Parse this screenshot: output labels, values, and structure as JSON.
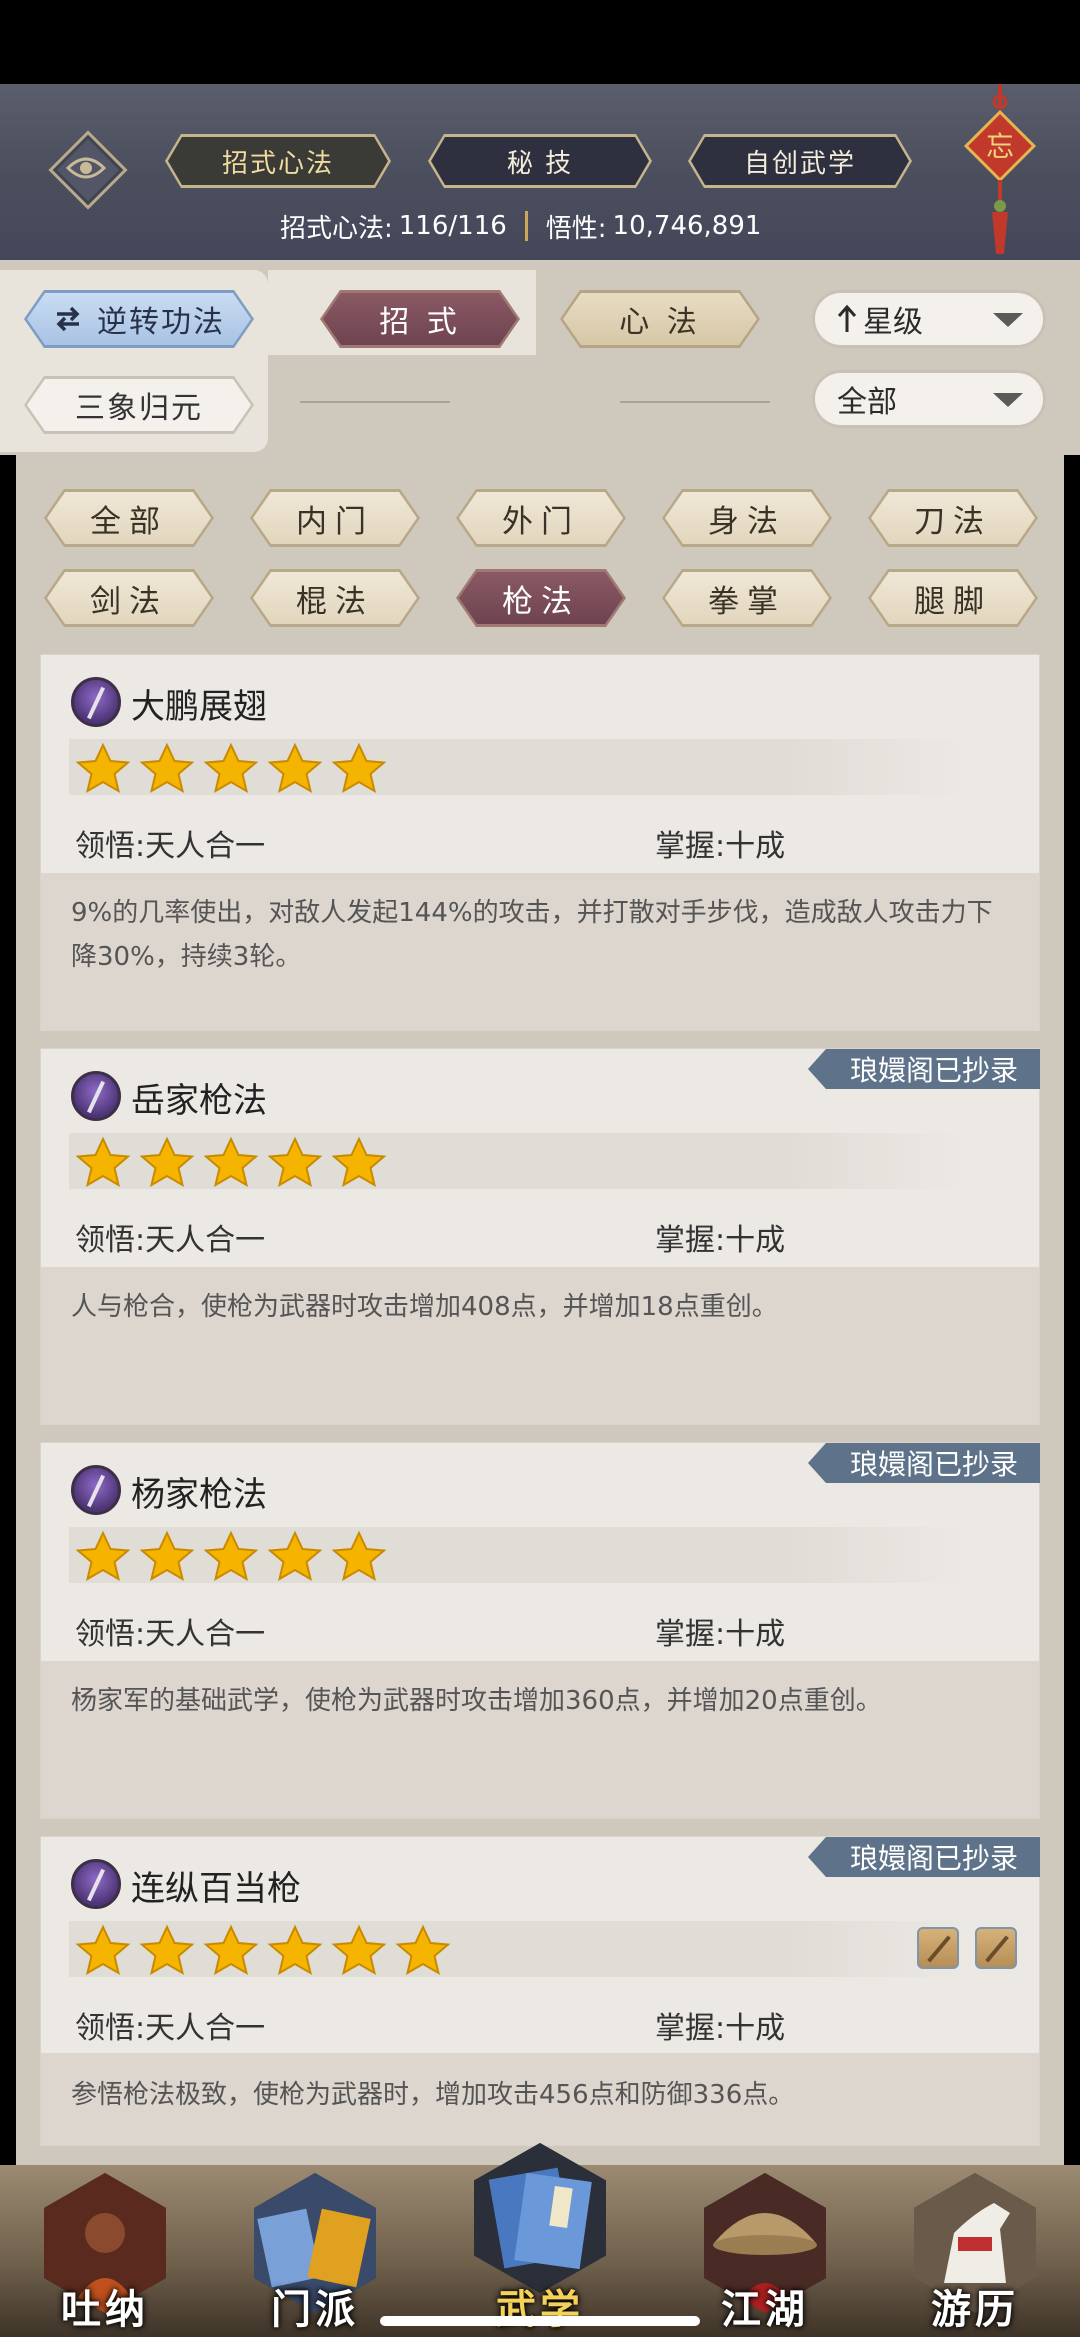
{
  "header": {
    "tabs": [
      {
        "label": "招式心法",
        "active": true
      },
      {
        "label": "秘 技",
        "active": false
      },
      {
        "label": "自创武学",
        "active": false
      }
    ],
    "stats": {
      "moves_label": "招式心法:",
      "moves_value": "116/116",
      "insight_label": "悟性:",
      "insight_value": "10,746,891"
    },
    "pendant_char": "忘"
  },
  "filters": {
    "reverse_button": "逆转功法",
    "type_tabs": [
      {
        "label": "招 式",
        "active": true
      },
      {
        "label": "心 法",
        "active": false
      }
    ],
    "sanxiang_button": "三象归元",
    "sort_dropdown": "星级",
    "scope_dropdown": "全部"
  },
  "categories": [
    {
      "label": "全部",
      "active": false
    },
    {
      "label": "内门",
      "active": false
    },
    {
      "label": "外门",
      "active": false
    },
    {
      "label": "身法",
      "active": false
    },
    {
      "label": "刀法",
      "active": false
    },
    {
      "label": "剑法",
      "active": false
    },
    {
      "label": "棍法",
      "active": false
    },
    {
      "label": "枪法",
      "active": true
    },
    {
      "label": "拳掌",
      "active": false
    },
    {
      "label": "腿脚",
      "active": false
    }
  ],
  "skills": [
    {
      "name": "大鹏展翅",
      "stars": 5,
      "comprehension": "领悟:天人合一",
      "mastery": "掌握:十成",
      "description": "9%的几率使出，对敌人发起144%的攻击，并打散对手步伐，造成敌人攻击力下降30%，持续3轮。",
      "badge": ""
    },
    {
      "name": "岳家枪法",
      "stars": 5,
      "comprehension": "领悟:天人合一",
      "mastery": "掌握:十成",
      "description": "人与枪合，使枪为武器时攻击增加408点，并增加18点重创。",
      "badge": "琅嬛阁已抄录"
    },
    {
      "name": "杨家枪法",
      "stars": 5,
      "comprehension": "领悟:天人合一",
      "mastery": "掌握:十成",
      "description": "杨家军的基础武学，使枪为武器时攻击增加360点，并增加20点重创。",
      "badge": "琅嬛阁已抄录"
    },
    {
      "name": "连纵百当枪",
      "stars": 6,
      "comprehension": "领悟:天人合一",
      "mastery": "掌握:十成",
      "description": "参悟枪法极致，使枪为武器时，增加攻击456点和防御336点。",
      "badge": "琅嬛阁已抄录"
    }
  ],
  "bottom_nav": [
    {
      "label": "吐纳",
      "icon": "monk-icon",
      "active": false
    },
    {
      "label": "门派",
      "icon": "sect-flags-icon",
      "active": false
    },
    {
      "label": "武学",
      "icon": "book-icon",
      "active": true
    },
    {
      "label": "江湖",
      "icon": "straw-hat-icon",
      "active": false
    },
    {
      "label": "游历",
      "icon": "horse-icon",
      "active": false
    }
  ],
  "colors": {
    "active_tab": "#7a4e5a",
    "badge": "#5e738a",
    "star": "#f5b400",
    "nav_active": "#f4d25a"
  }
}
